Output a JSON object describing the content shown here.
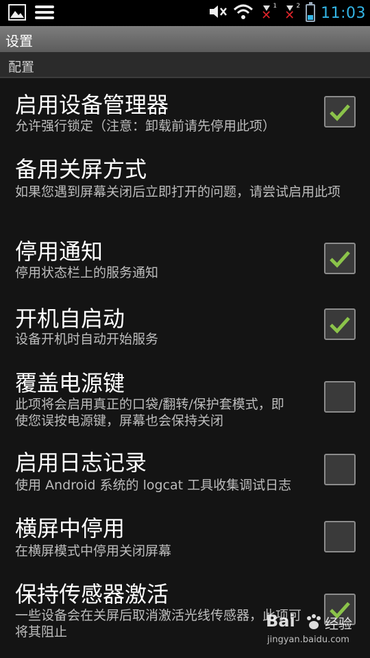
{
  "status_bar": {
    "time": "11:03",
    "sim1_label": "1",
    "sim2_label": "2",
    "icons": [
      "image-icon",
      "menu-icon",
      "mute-icon",
      "wifi-icon",
      "no-signal-icon",
      "battery-icon"
    ],
    "battery_level": 0.3,
    "accent": "#33b5e5"
  },
  "title": "设置",
  "section_header": "配置",
  "preferences": [
    {
      "title": "启用设备管理器",
      "summary": "允许强行锁定（注意：卸载前请先停用此项）",
      "checked": true
    },
    {
      "title": "备用关屏方式",
      "summary": "如果您遇到屏幕关闭后立即打开的问题，请尝试启用此项",
      "checked": null
    },
    {
      "title": "停用通知",
      "summary": "停用状态栏上的服务通知",
      "checked": true
    },
    {
      "title": "开机自启动",
      "summary": "设备开机时自动开始服务",
      "checked": true
    },
    {
      "title": "覆盖电源键",
      "summary": "此项将会启用真正的口袋/翻转/保护套模式，即使您误按电源键，屏幕也会保持关闭",
      "checked": false
    },
    {
      "title": "启用日志记录",
      "summary": "使用 Android 系统的 logcat 工具收集调试日志",
      "checked": false
    },
    {
      "title": "横屏中停用",
      "summary": "在横屏模式中停用关闭屏幕",
      "checked": false
    },
    {
      "title": "保持传感器激活",
      "summary": "一些设备会在关屏后取消激活光线传感器，此项可将其阻止",
      "checked": true
    }
  ],
  "watermark": {
    "brand": "Bai",
    "brand2": "经验",
    "url": "jingyan.baidu.com"
  },
  "colors": {
    "check_green": "#8bc34a",
    "background": "#141414"
  }
}
